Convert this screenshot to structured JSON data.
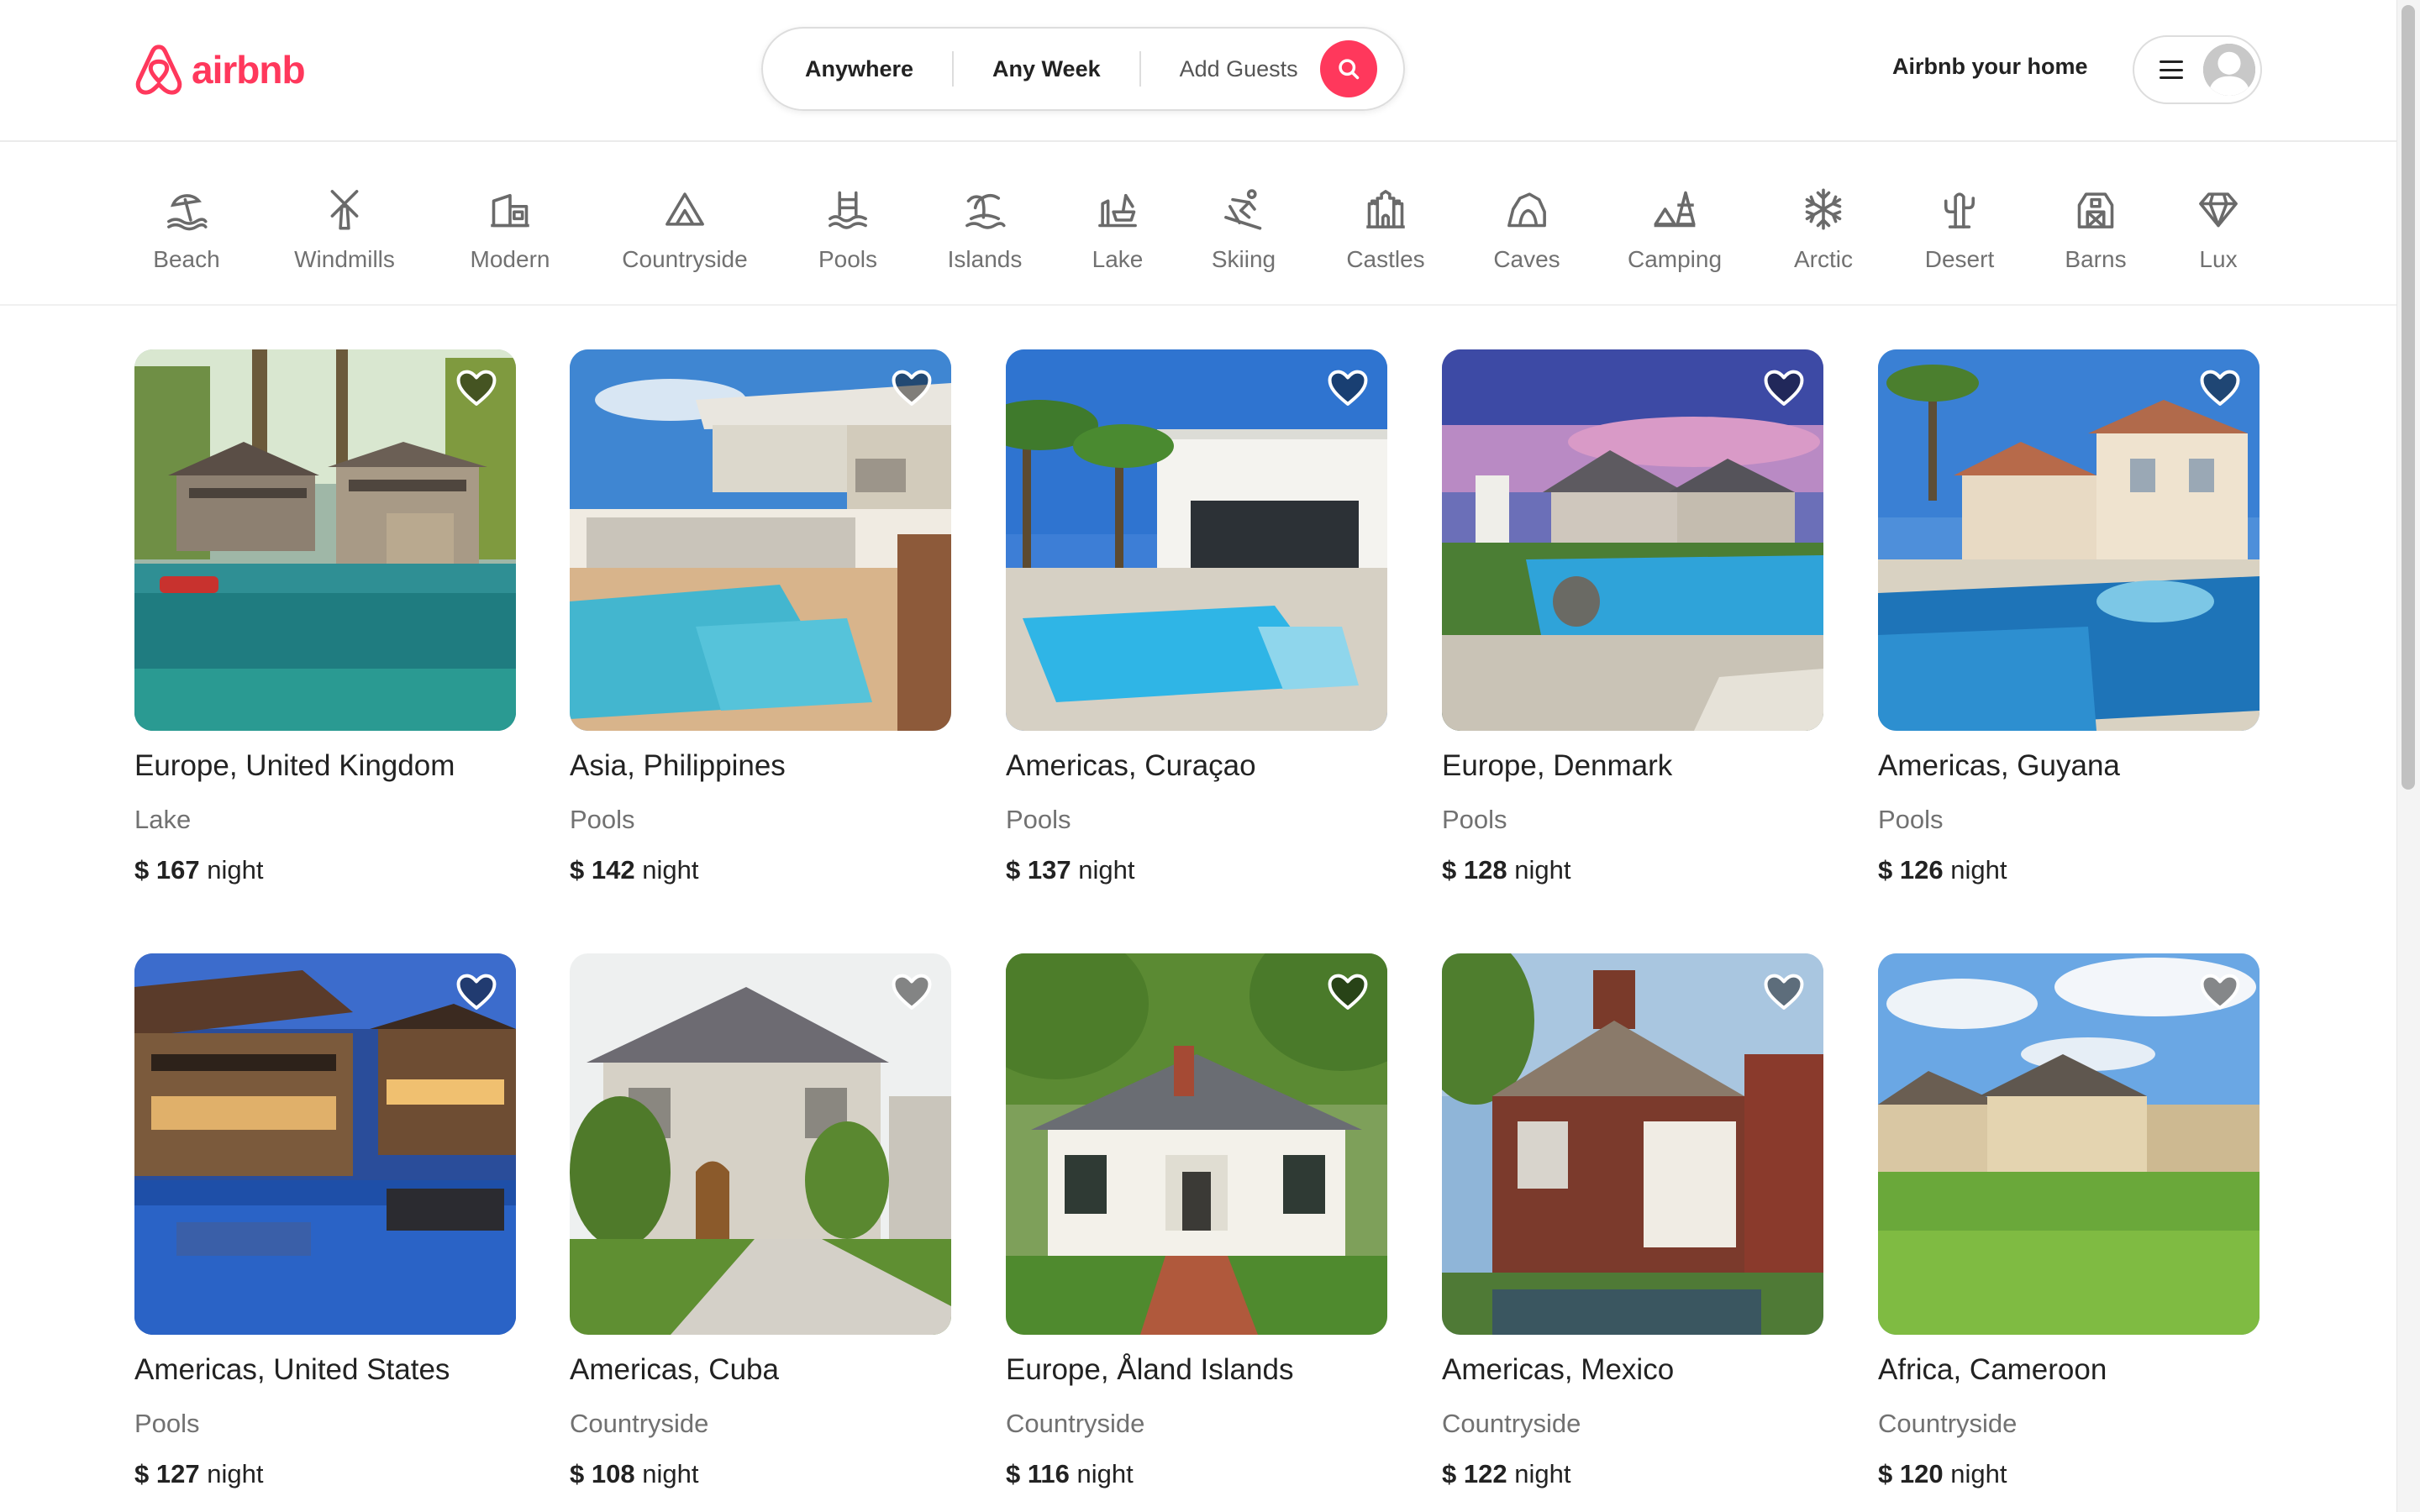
{
  "brand": {
    "name": "airbnb",
    "color": "#ff385c"
  },
  "search": {
    "where": "Anywhere",
    "when": "Any Week",
    "guests": "Add Guests",
    "button_icon": "search-icon"
  },
  "header": {
    "host_link": "Airbnb your home",
    "menu_icon": "menu-icon",
    "avatar_icon": "user-avatar-icon"
  },
  "categories": [
    {
      "label": "Beach",
      "icon": "beach-icon"
    },
    {
      "label": "Windmills",
      "icon": "windmill-icon"
    },
    {
      "label": "Modern",
      "icon": "modern-house-icon"
    },
    {
      "label": "Countryside",
      "icon": "countryside-icon"
    },
    {
      "label": "Pools",
      "icon": "pool-icon"
    },
    {
      "label": "Islands",
      "icon": "island-icon"
    },
    {
      "label": "Lake",
      "icon": "lake-icon"
    },
    {
      "label": "Skiing",
      "icon": "skiing-icon"
    },
    {
      "label": "Castles",
      "icon": "castle-icon"
    },
    {
      "label": "Caves",
      "icon": "cave-icon"
    },
    {
      "label": "Camping",
      "icon": "camping-icon"
    },
    {
      "label": "Arctic",
      "icon": "snowflake-icon"
    },
    {
      "label": "Desert",
      "icon": "cactus-icon"
    },
    {
      "label": "Barns",
      "icon": "barn-icon"
    },
    {
      "label": "Lux",
      "icon": "diamond-icon"
    }
  ],
  "listings": [
    {
      "location": "Europe, United Kingdom",
      "category": "Lake",
      "price": "$ 167",
      "unit": "night"
    },
    {
      "location": "Asia, Philippines",
      "category": "Pools",
      "price": "$ 142",
      "unit": "night"
    },
    {
      "location": "Americas, Curaçao",
      "category": "Pools",
      "price": "$ 137",
      "unit": "night"
    },
    {
      "location": "Europe, Denmark",
      "category": "Pools",
      "price": "$ 128",
      "unit": "night"
    },
    {
      "location": "Americas, Guyana",
      "category": "Pools",
      "price": "$ 126",
      "unit": "night"
    },
    {
      "location": "Americas, United States",
      "category": "Pools",
      "price": "$ 127",
      "unit": "night"
    },
    {
      "location": "Americas, Cuba",
      "category": "Countryside",
      "price": "$ 108",
      "unit": "night"
    },
    {
      "location": "Europe, Åland Islands",
      "category": "Countryside",
      "price": "$ 116",
      "unit": "night"
    },
    {
      "location": "Americas, Mexico",
      "category": "Countryside",
      "price": "$ 122",
      "unit": "night"
    },
    {
      "location": "Africa, Cameroon",
      "category": "Countryside",
      "price": "$ 120",
      "unit": "night"
    }
  ]
}
